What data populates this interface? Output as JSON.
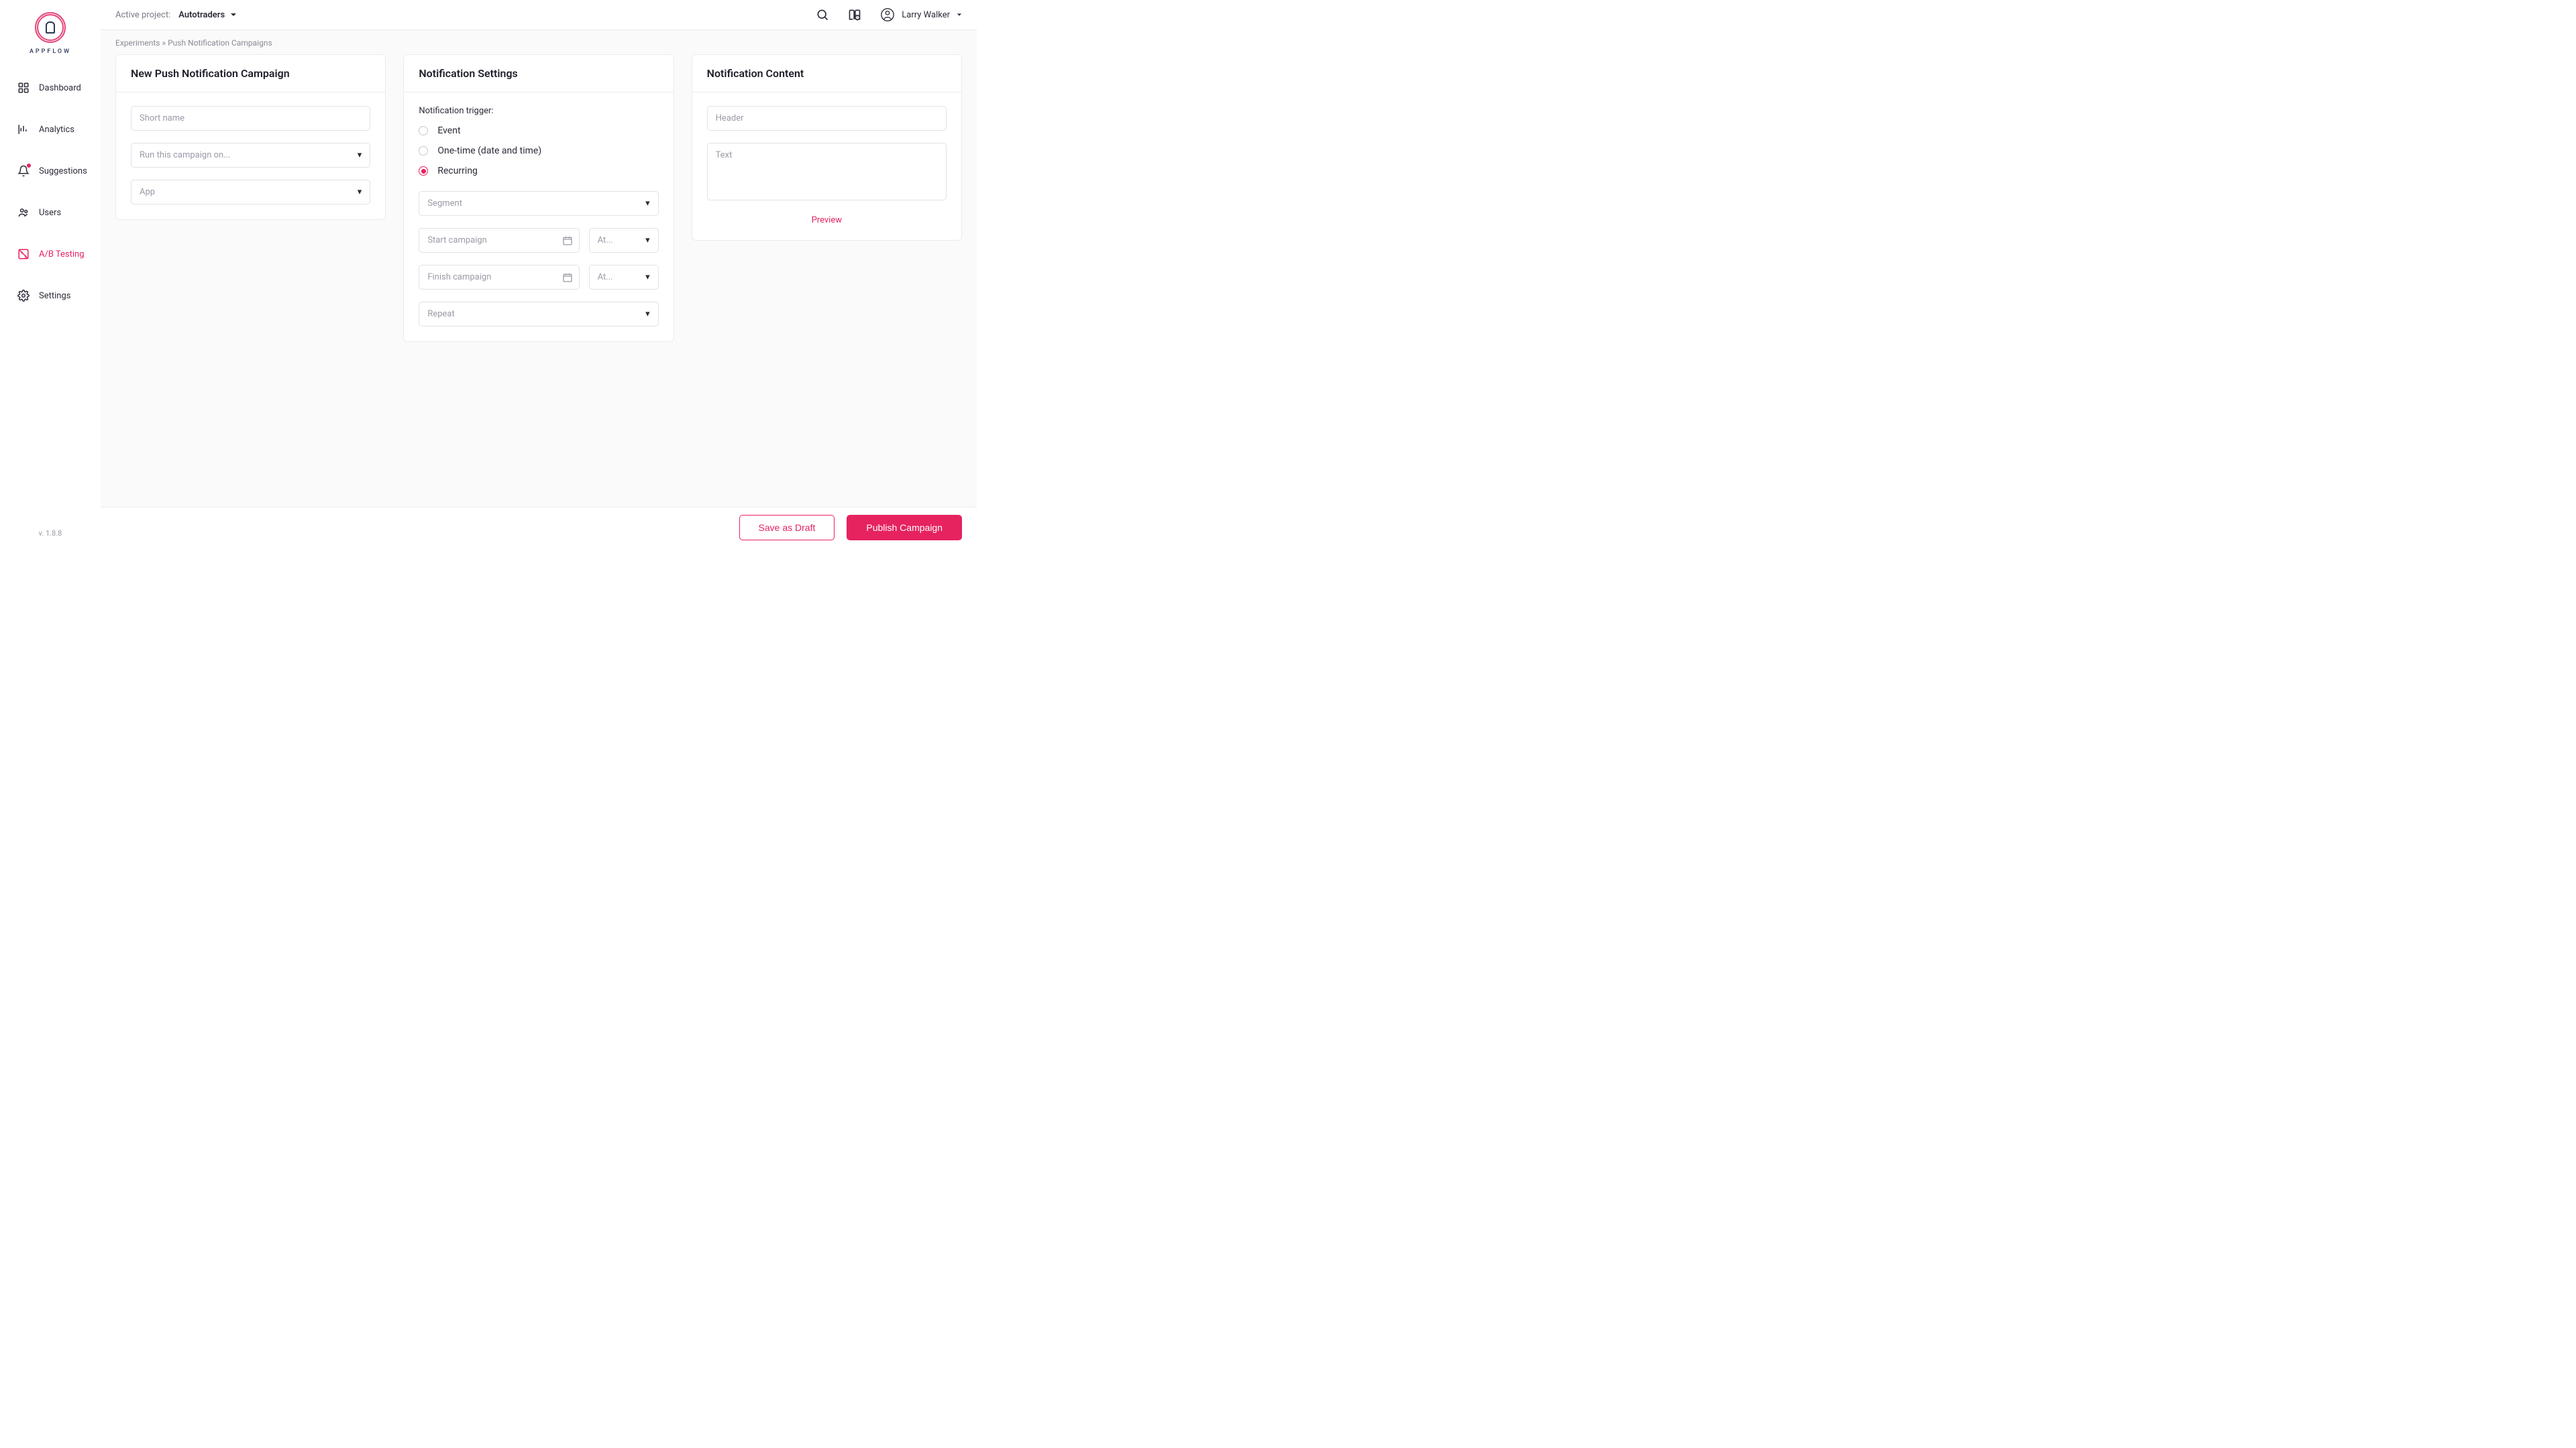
{
  "brand": "APPFLOW",
  "version": "v. 1.8.8",
  "sidebar": {
    "items": [
      {
        "label": "Dashboard",
        "icon": "grid-icon"
      },
      {
        "label": "Analytics",
        "icon": "chart-icon"
      },
      {
        "label": "Suggestions",
        "icon": "bell-icon",
        "badge": true
      },
      {
        "label": "Users",
        "icon": "users-icon"
      },
      {
        "label": "A/B Testing",
        "icon": "ab-icon",
        "active": true
      },
      {
        "label": "Settings",
        "icon": "gear-icon"
      }
    ]
  },
  "topbar": {
    "project_label": "Active project:",
    "project_value": "Autotraders",
    "user_name": "Larry Walker"
  },
  "breadcrumb": {
    "root": "Experiments",
    "sep": "»",
    "current": "Push Notification Campaigns"
  },
  "cards": {
    "campaign": {
      "title": "New Push Notification Campaign",
      "short_name_placeholder": "Short name",
      "run_on_placeholder": "Run this campaign on...",
      "app_placeholder": "App"
    },
    "settings": {
      "title": "Notification Settings",
      "trigger_label": "Notification trigger:",
      "opts": [
        "Event",
        "One-time (date and time)",
        "Recurring"
      ],
      "segment_placeholder": "Segment",
      "start_placeholder": "Start campaign",
      "finish_placeholder": "Finish campaign",
      "at_placeholder": "At...",
      "repeat_placeholder": "Repeat"
    },
    "content": {
      "title": "Notification Content",
      "header_placeholder": "Header",
      "text_placeholder": "Text",
      "preview": "Preview"
    }
  },
  "footer": {
    "draft": "Save as Draft",
    "publish": "Publish Campaign"
  }
}
